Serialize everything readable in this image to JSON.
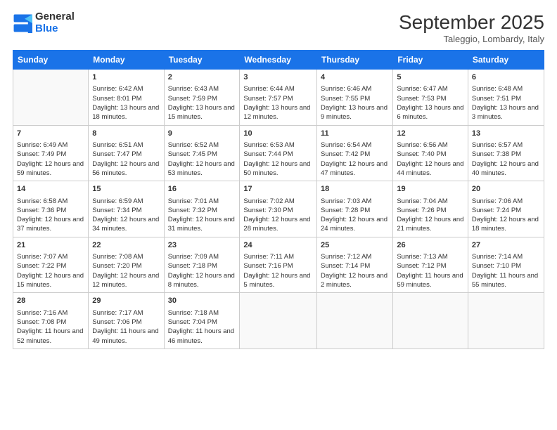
{
  "logo": {
    "general": "General",
    "blue": "Blue"
  },
  "title": "September 2025",
  "location": "Taleggio, Lombardy, Italy",
  "weekdays": [
    "Sunday",
    "Monday",
    "Tuesday",
    "Wednesday",
    "Thursday",
    "Friday",
    "Saturday"
  ],
  "weeks": [
    [
      {
        "day": "",
        "sunrise": "",
        "sunset": "",
        "daylight": ""
      },
      {
        "day": "1",
        "sunrise": "Sunrise: 6:42 AM",
        "sunset": "Sunset: 8:01 PM",
        "daylight": "Daylight: 13 hours and 18 minutes."
      },
      {
        "day": "2",
        "sunrise": "Sunrise: 6:43 AM",
        "sunset": "Sunset: 7:59 PM",
        "daylight": "Daylight: 13 hours and 15 minutes."
      },
      {
        "day": "3",
        "sunrise": "Sunrise: 6:44 AM",
        "sunset": "Sunset: 7:57 PM",
        "daylight": "Daylight: 13 hours and 12 minutes."
      },
      {
        "day": "4",
        "sunrise": "Sunrise: 6:46 AM",
        "sunset": "Sunset: 7:55 PM",
        "daylight": "Daylight: 13 hours and 9 minutes."
      },
      {
        "day": "5",
        "sunrise": "Sunrise: 6:47 AM",
        "sunset": "Sunset: 7:53 PM",
        "daylight": "Daylight: 13 hours and 6 minutes."
      },
      {
        "day": "6",
        "sunrise": "Sunrise: 6:48 AM",
        "sunset": "Sunset: 7:51 PM",
        "daylight": "Daylight: 13 hours and 3 minutes."
      }
    ],
    [
      {
        "day": "7",
        "sunrise": "Sunrise: 6:49 AM",
        "sunset": "Sunset: 7:49 PM",
        "daylight": "Daylight: 12 hours and 59 minutes."
      },
      {
        "day": "8",
        "sunrise": "Sunrise: 6:51 AM",
        "sunset": "Sunset: 7:47 PM",
        "daylight": "Daylight: 12 hours and 56 minutes."
      },
      {
        "day": "9",
        "sunrise": "Sunrise: 6:52 AM",
        "sunset": "Sunset: 7:45 PM",
        "daylight": "Daylight: 12 hours and 53 minutes."
      },
      {
        "day": "10",
        "sunrise": "Sunrise: 6:53 AM",
        "sunset": "Sunset: 7:44 PM",
        "daylight": "Daylight: 12 hours and 50 minutes."
      },
      {
        "day": "11",
        "sunrise": "Sunrise: 6:54 AM",
        "sunset": "Sunset: 7:42 PM",
        "daylight": "Daylight: 12 hours and 47 minutes."
      },
      {
        "day": "12",
        "sunrise": "Sunrise: 6:56 AM",
        "sunset": "Sunset: 7:40 PM",
        "daylight": "Daylight: 12 hours and 44 minutes."
      },
      {
        "day": "13",
        "sunrise": "Sunrise: 6:57 AM",
        "sunset": "Sunset: 7:38 PM",
        "daylight": "Daylight: 12 hours and 40 minutes."
      }
    ],
    [
      {
        "day": "14",
        "sunrise": "Sunrise: 6:58 AM",
        "sunset": "Sunset: 7:36 PM",
        "daylight": "Daylight: 12 hours and 37 minutes."
      },
      {
        "day": "15",
        "sunrise": "Sunrise: 6:59 AM",
        "sunset": "Sunset: 7:34 PM",
        "daylight": "Daylight: 12 hours and 34 minutes."
      },
      {
        "day": "16",
        "sunrise": "Sunrise: 7:01 AM",
        "sunset": "Sunset: 7:32 PM",
        "daylight": "Daylight: 12 hours and 31 minutes."
      },
      {
        "day": "17",
        "sunrise": "Sunrise: 7:02 AM",
        "sunset": "Sunset: 7:30 PM",
        "daylight": "Daylight: 12 hours and 28 minutes."
      },
      {
        "day": "18",
        "sunrise": "Sunrise: 7:03 AM",
        "sunset": "Sunset: 7:28 PM",
        "daylight": "Daylight: 12 hours and 24 minutes."
      },
      {
        "day": "19",
        "sunrise": "Sunrise: 7:04 AM",
        "sunset": "Sunset: 7:26 PM",
        "daylight": "Daylight: 12 hours and 21 minutes."
      },
      {
        "day": "20",
        "sunrise": "Sunrise: 7:06 AM",
        "sunset": "Sunset: 7:24 PM",
        "daylight": "Daylight: 12 hours and 18 minutes."
      }
    ],
    [
      {
        "day": "21",
        "sunrise": "Sunrise: 7:07 AM",
        "sunset": "Sunset: 7:22 PM",
        "daylight": "Daylight: 12 hours and 15 minutes."
      },
      {
        "day": "22",
        "sunrise": "Sunrise: 7:08 AM",
        "sunset": "Sunset: 7:20 PM",
        "daylight": "Daylight: 12 hours and 12 minutes."
      },
      {
        "day": "23",
        "sunrise": "Sunrise: 7:09 AM",
        "sunset": "Sunset: 7:18 PM",
        "daylight": "Daylight: 12 hours and 8 minutes."
      },
      {
        "day": "24",
        "sunrise": "Sunrise: 7:11 AM",
        "sunset": "Sunset: 7:16 PM",
        "daylight": "Daylight: 12 hours and 5 minutes."
      },
      {
        "day": "25",
        "sunrise": "Sunrise: 7:12 AM",
        "sunset": "Sunset: 7:14 PM",
        "daylight": "Daylight: 12 hours and 2 minutes."
      },
      {
        "day": "26",
        "sunrise": "Sunrise: 7:13 AM",
        "sunset": "Sunset: 7:12 PM",
        "daylight": "Daylight: 11 hours and 59 minutes."
      },
      {
        "day": "27",
        "sunrise": "Sunrise: 7:14 AM",
        "sunset": "Sunset: 7:10 PM",
        "daylight": "Daylight: 11 hours and 55 minutes."
      }
    ],
    [
      {
        "day": "28",
        "sunrise": "Sunrise: 7:16 AM",
        "sunset": "Sunset: 7:08 PM",
        "daylight": "Daylight: 11 hours and 52 minutes."
      },
      {
        "day": "29",
        "sunrise": "Sunrise: 7:17 AM",
        "sunset": "Sunset: 7:06 PM",
        "daylight": "Daylight: 11 hours and 49 minutes."
      },
      {
        "day": "30",
        "sunrise": "Sunrise: 7:18 AM",
        "sunset": "Sunset: 7:04 PM",
        "daylight": "Daylight: 11 hours and 46 minutes."
      },
      {
        "day": "",
        "sunrise": "",
        "sunset": "",
        "daylight": ""
      },
      {
        "day": "",
        "sunrise": "",
        "sunset": "",
        "daylight": ""
      },
      {
        "day": "",
        "sunrise": "",
        "sunset": "",
        "daylight": ""
      },
      {
        "day": "",
        "sunrise": "",
        "sunset": "",
        "daylight": ""
      }
    ]
  ]
}
